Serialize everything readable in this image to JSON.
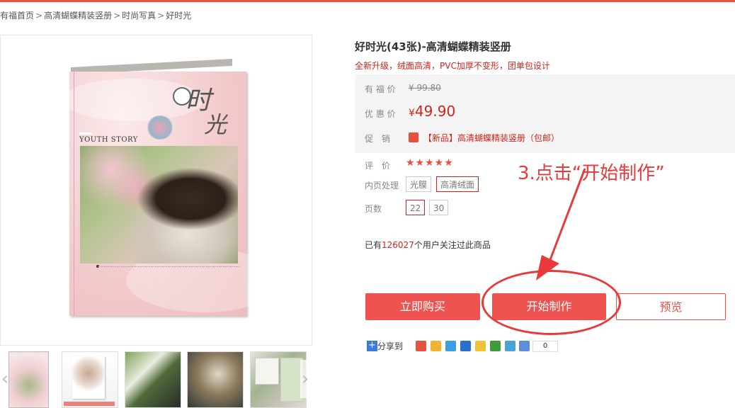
{
  "breadcrumb": {
    "items": [
      "有福首页",
      "高清蝴蝶精装竖册",
      "时尚写真",
      "好时光"
    ],
    "separator": ">"
  },
  "gallery": {
    "main_image": {
      "cover_text_en": "YOUTH STORY",
      "cover_title_1": "时",
      "cover_title_2": "光"
    },
    "thumbnails_count": 5
  },
  "product": {
    "title": "好时光(43张)-高清蝴蝶精装竖册",
    "subtitle": "全新升级，绒面高清，PVC加厚不变形，团单包设计",
    "price_label_orig": "有 福 价",
    "price_orig": "¥ 99.80",
    "price_label_sale": "优 惠 价",
    "price_currency": "¥",
    "price_sale": "49.90",
    "promo_label": "促　销",
    "promo_text": "【新品】高清蝴蝶精装竖册（包邮）",
    "rating_label": "评　价",
    "rating_stars": "★★★★★",
    "inner_label": "内页处理",
    "inner_options": [
      "光膜",
      "高清绒面"
    ],
    "pages_label": "页数",
    "pages_options": [
      "22",
      "30"
    ],
    "followers_prefix": "已有",
    "followers_count": "126027",
    "followers_suffix": "个用户关注过此商品"
  },
  "actions": {
    "buy": "立即购买",
    "make": "开始制作",
    "preview": "预览"
  },
  "share": {
    "label": "分享到",
    "count": "0"
  },
  "annotation": {
    "text": "3.点击“开始制作”"
  },
  "colors": {
    "accent": "#e9503e",
    "price": "#d4231b",
    "annotation": "#e83a3a"
  }
}
